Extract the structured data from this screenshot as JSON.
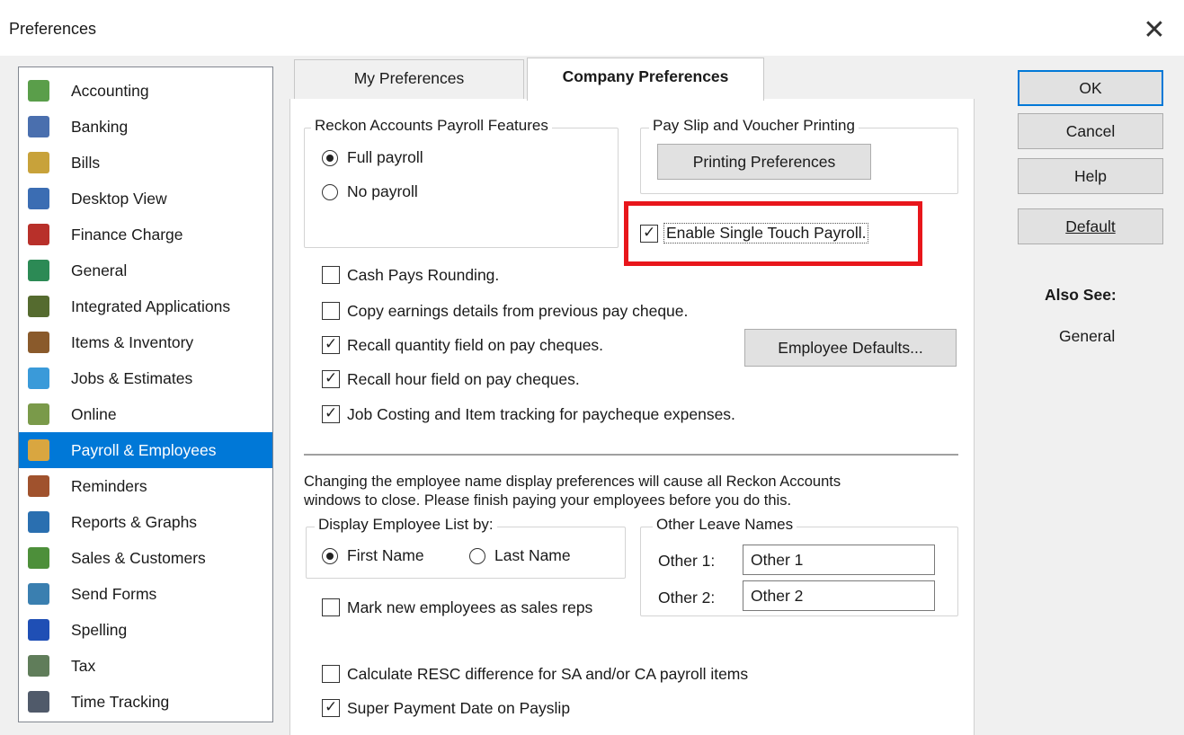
{
  "window": {
    "title": "Preferences",
    "close_icon": "close-icon"
  },
  "sidebar": {
    "selected_index": 11,
    "items": [
      {
        "label": "Accounting",
        "icon": "accounting-icon",
        "color": "#5a9e4a"
      },
      {
        "label": "Banking",
        "icon": "banking-icon",
        "color": "#4a6fae"
      },
      {
        "label": "Bills",
        "icon": "bills-icon",
        "color": "#c8a23a"
      },
      {
        "label": "Desktop View",
        "icon": "desktop-view-icon",
        "color": "#3b6db3"
      },
      {
        "label": "Finance Charge",
        "icon": "finance-charge-icon",
        "color": "#b8302a"
      },
      {
        "label": "General",
        "icon": "general-icon",
        "color": "#2c8a55"
      },
      {
        "label": "Integrated Applications",
        "icon": "integrated-applications-icon",
        "color": "#556b2f"
      },
      {
        "label": "Items & Inventory",
        "icon": "items-inventory-icon",
        "color": "#8a5a2b"
      },
      {
        "label": "Jobs & Estimates",
        "icon": "jobs-estimates-icon",
        "color": "#3a9ad9"
      },
      {
        "label": "Online",
        "icon": "online-icon",
        "color": "#7a9a4a"
      },
      {
        "label": "Payroll & Employees",
        "icon": "payroll-employees-icon",
        "color": "#6a9ad0"
      },
      {
        "label": "Payroll & Employees",
        "icon": "payroll-employees-icon",
        "color": "#d9a640"
      },
      {
        "label": "Reminders",
        "icon": "reminders-icon",
        "color": "#a0522d"
      },
      {
        "label": "Reports & Graphs",
        "icon": "reports-graphs-icon",
        "color": "#2a6fb0"
      },
      {
        "label": "Sales & Customers",
        "icon": "sales-customers-icon",
        "color": "#4d8f3a"
      },
      {
        "label": "Send Forms",
        "icon": "send-forms-icon",
        "color": "#3a7fb0"
      },
      {
        "label": "Spelling",
        "icon": "spelling-icon",
        "color": "#1f4fb5"
      },
      {
        "label": "Tax",
        "icon": "tax-icon",
        "color": "#607d5a"
      },
      {
        "label": "Time Tracking",
        "icon": "time-tracking-icon",
        "color": "#505a6a"
      }
    ]
  },
  "tabs": [
    {
      "label": "My Preferences",
      "active": false
    },
    {
      "label": "Company Preferences",
      "active": true
    }
  ],
  "company": {
    "payroll_features": {
      "legend": "Reckon Accounts Payroll Features",
      "options": [
        {
          "label": "Full payroll",
          "checked": true
        },
        {
          "label": "No payroll",
          "checked": false
        }
      ]
    },
    "payslip": {
      "legend": "Pay Slip and Voucher Printing",
      "printing_button": "Printing Preferences"
    },
    "stp": {
      "label": "Enable Single Touch Payroll.",
      "checked": true,
      "highlight_color": "#e8161b"
    },
    "checkboxes": [
      {
        "label": "Cash Pays Rounding.",
        "checked": false
      },
      {
        "label": "Copy earnings details from previous pay cheque.",
        "checked": false
      },
      {
        "label": "Recall quantity field on pay cheques.",
        "checked": true
      },
      {
        "label": "Recall hour field on pay cheques.",
        "checked": true
      },
      {
        "label": "Job Costing and Item tracking for paycheque expenses.",
        "checked": true
      }
    ],
    "employee_defaults_button": "Employee Defaults...",
    "notice_line1": "Changing the employee name display preferences will cause all Reckon Accounts",
    "notice_line2": "windows to close. Please finish paying your employees before you do this.",
    "display_list": {
      "legend": "Display Employee List by:",
      "options": [
        {
          "label": "First Name",
          "checked": true
        },
        {
          "label": "Last Name",
          "checked": false
        }
      ]
    },
    "mark_sales_reps": {
      "label": "Mark new employees as sales reps",
      "checked": false
    },
    "other_leave": {
      "legend": "Other Leave Names",
      "fields": [
        {
          "label": "Other 1:",
          "value": "Other 1"
        },
        {
          "label": "Other 2:",
          "value": "Other 2"
        }
      ]
    },
    "bottom_checkboxes": [
      {
        "label": "Calculate RESC difference for SA and/or CA payroll items",
        "checked": false
      },
      {
        "label": "Super Payment Date on Payslip",
        "checked": true
      }
    ]
  },
  "buttons": {
    "ok": "OK",
    "cancel": "Cancel",
    "help": "Help",
    "default": "Default"
  },
  "also_see": {
    "heading": "Also See:",
    "link": "General"
  }
}
